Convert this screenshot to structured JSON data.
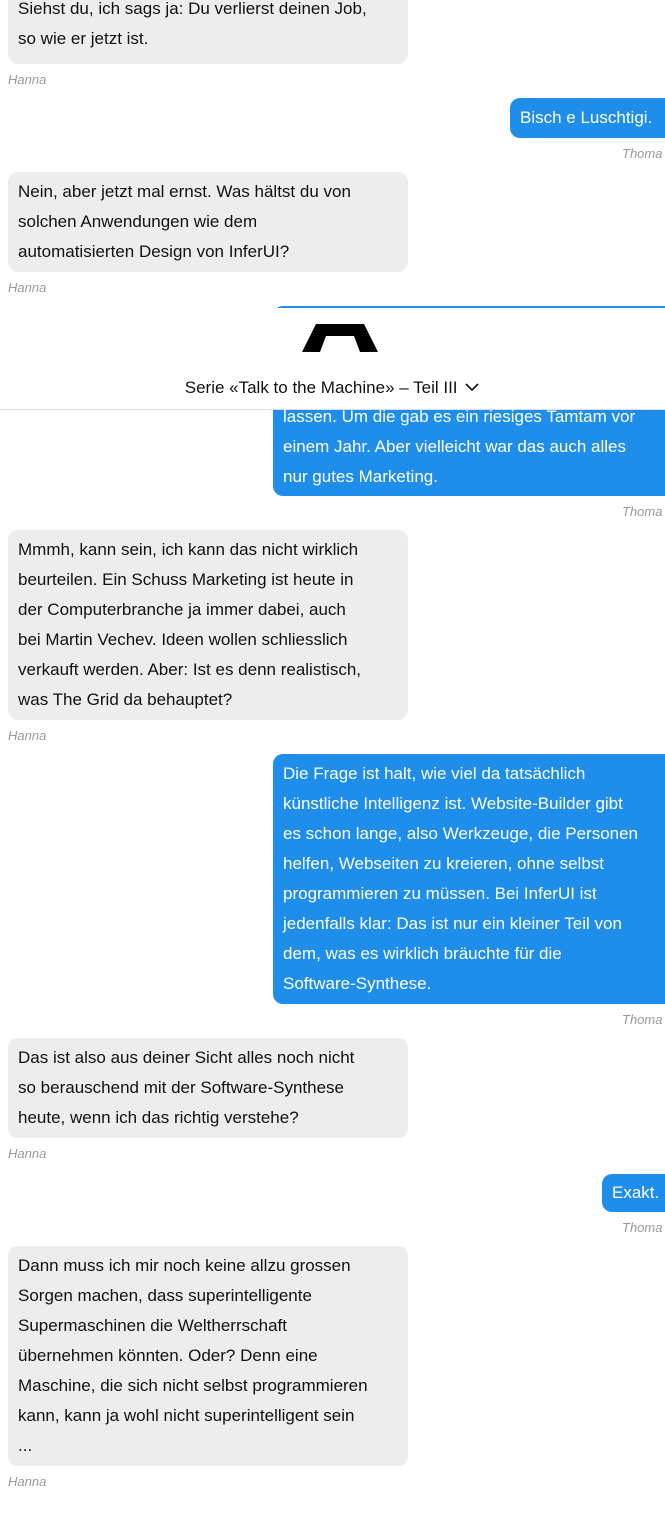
{
  "header": {
    "series_label": "Serie «Talk to the Machine» – Teil III"
  },
  "messages": [
    {
      "sender": "Hanna",
      "text": "Siehst du, ich sags ja: Du verlierst deinen Job,\nso wie er jetzt ist."
    },
    {
      "sender": "Thoma",
      "text": "Bisch e Luschtigi."
    },
    {
      "sender": "Hanna",
      "text": "Nein, aber jetzt mal ernst. Was hältst du von\nsolchen Anwendungen wie dem\nautomatisierten Design von InferUI?"
    },
    {
      "sender": "Thoma",
      "text": "lassen. Um die gab es ein riesiges Tamtam vor\neinem Jahr. Aber vielleicht war das auch alles\nnur gutes Marketing."
    },
    {
      "sender": "Hanna",
      "text": "Mmmh, kann sein, ich kann das nicht wirklich\nbeurteilen. Ein Schuss Marketing ist heute in\nder Computerbranche ja immer dabei, auch\nbei Martin Vechev. Ideen wollen schliesslich\nverkauft werden. Aber: Ist es denn realistisch,\nwas The Grid da behauptet?"
    },
    {
      "sender": "Thoma",
      "text": "Die Frage ist halt, wie viel da tatsächlich\nkünstliche Intelligenz ist. Website-Builder gibt\nes schon lange, also Werkzeuge, die Personen\nhelfen, Webseiten zu kreieren, ohne selbst\nprogrammieren zu müssen. Bei InferUI ist\njedenfalls klar: Das ist nur ein kleiner Teil von\ndem, was es wirklich bräuchte für die\nSoftware-Synthese."
    },
    {
      "sender": "Hanna",
      "text": "Das ist also aus deiner Sicht alles noch nicht\nso berauschend mit der Software-Synthese\nheute, wenn ich das richtig verstehe?"
    },
    {
      "sender": "Thoma",
      "text": "Exakt."
    },
    {
      "sender": "Hanna",
      "text": "Dann muss ich mir noch keine allzu grossen\nSorgen machen, dass superintelligente\nSupermaschinen die Weltherrschaft\nübernehmen könnten. Oder? Denn eine\nMaschine, die sich nicht selbst programmieren\nkann, kann ja wohl nicht superintelligent sein\n..."
    }
  ]
}
